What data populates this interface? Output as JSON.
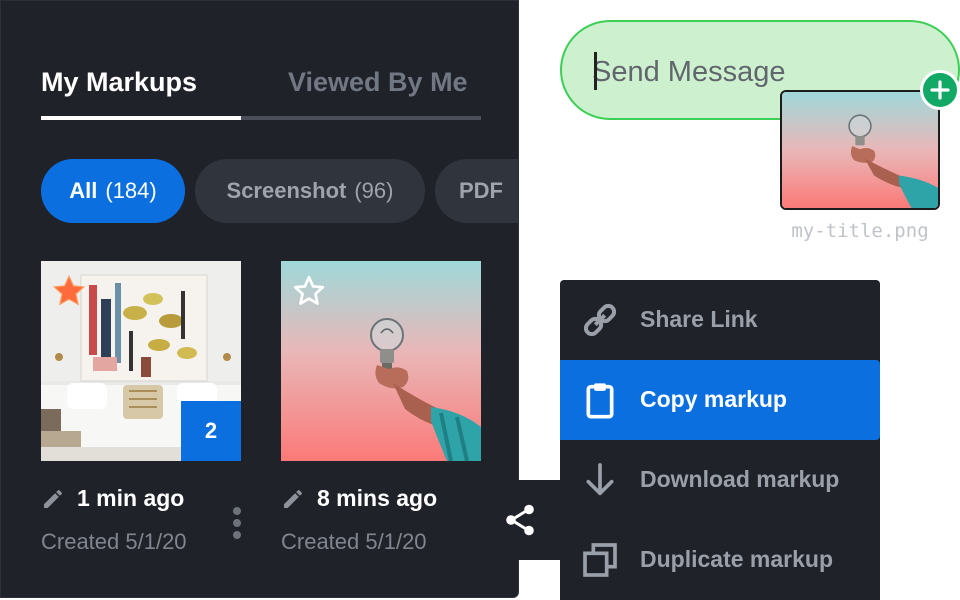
{
  "tabs": [
    {
      "label": "My Markups",
      "active": true
    },
    {
      "label": "Viewed By Me",
      "active": false
    }
  ],
  "filters": [
    {
      "label": "All",
      "count": "(184)",
      "selected": true
    },
    {
      "label": "Screenshot",
      "count": "(96)",
      "selected": false
    },
    {
      "label": "PDF",
      "count": "",
      "selected": false
    }
  ],
  "cards": [
    {
      "time": "1 min ago",
      "created": "Created 5/1/20",
      "starred": true,
      "badge": "2"
    },
    {
      "time": "8 mins ago",
      "created": "Created 5/1/20",
      "starred": false
    }
  ],
  "menu": {
    "items": [
      {
        "label": "Share Link",
        "icon": "link-icon"
      },
      {
        "label": "Copy markup",
        "icon": "clipboard-icon",
        "highlighted": true
      },
      {
        "label": "Download markup",
        "icon": "download-arrow-icon"
      },
      {
        "label": "Duplicate markup",
        "icon": "duplicate-icon"
      }
    ]
  },
  "composer": {
    "placeholder": "Send Message",
    "attachment": {
      "filename": "my-title.png"
    }
  },
  "colors": {
    "panel_bg": "#1f2229",
    "accent_blue": "#0b6fe0",
    "composer_bg": "#cdf1cf",
    "composer_border": "#3bcf55",
    "add_badge": "#12a866"
  }
}
